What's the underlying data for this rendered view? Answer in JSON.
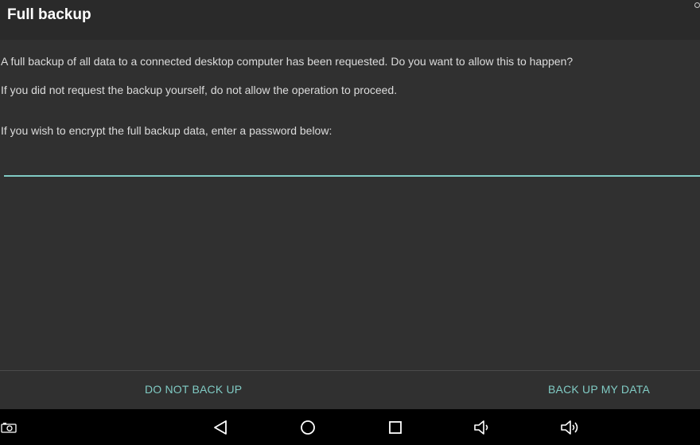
{
  "dialog": {
    "title": "Full backup",
    "message_request": "A full backup of all data to a connected desktop computer has been requested. Do you want to allow this to happen?",
    "message_warning": "If you did not request the backup yourself, do not allow the operation to proceed.",
    "message_encrypt": "If you wish to encrypt the full backup data, enter a password below:",
    "password_value": "",
    "password_placeholder": "",
    "deny_label": "DO NOT BACK UP",
    "allow_label": "BACK UP MY DATA"
  },
  "navbar": {
    "icons": [
      "screenshot-icon",
      "back-icon",
      "home-icon",
      "recents-icon",
      "volume-down-icon",
      "volume-up-icon"
    ]
  },
  "colors": {
    "accent": "#80cbc4",
    "background": "#303030",
    "titlebar": "#2a2a2a",
    "navbar": "#000000",
    "text": "#dcdcdc"
  }
}
